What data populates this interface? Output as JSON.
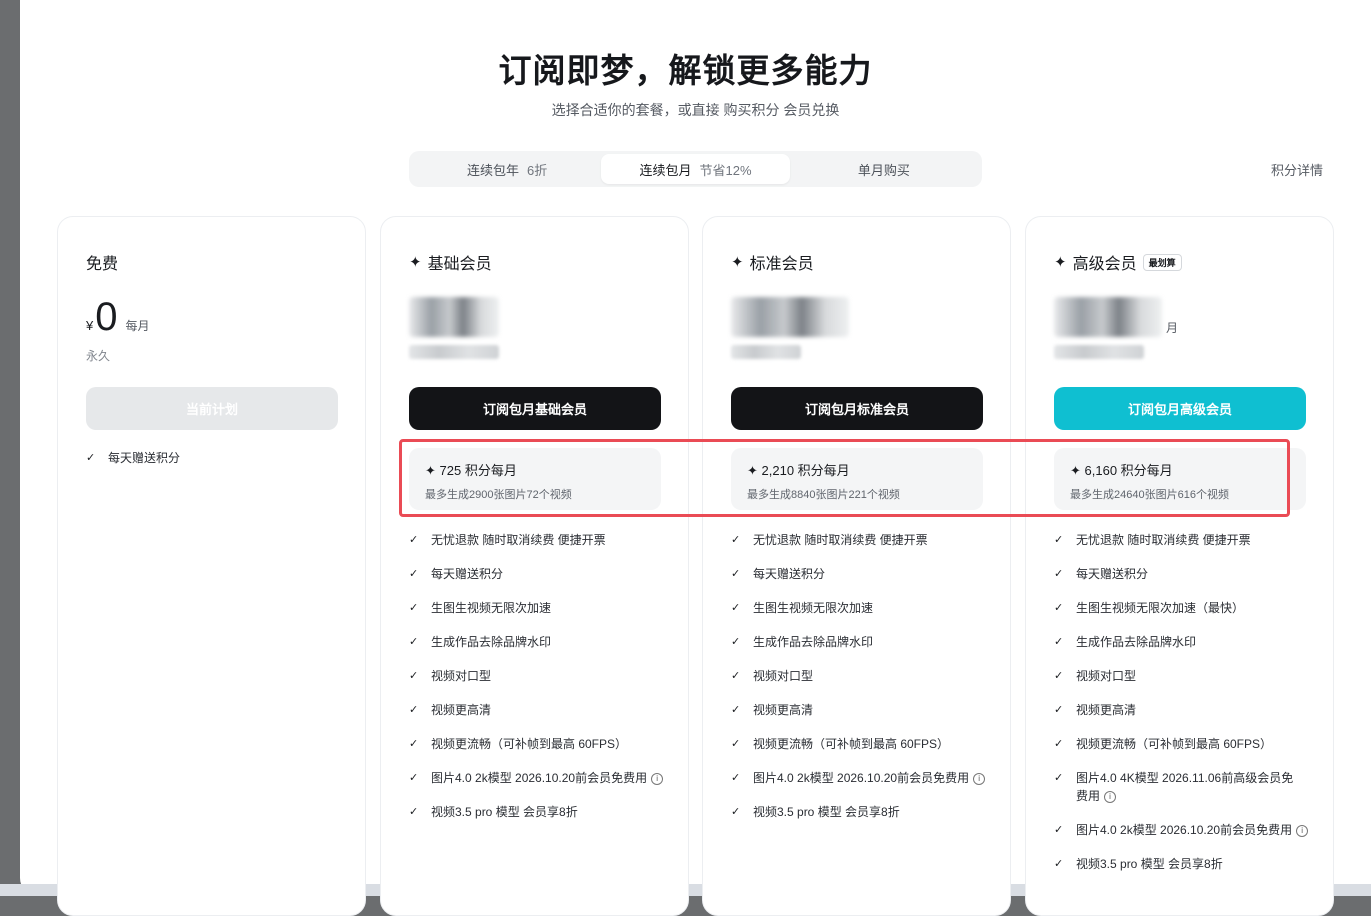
{
  "header": {
    "title": "订阅即梦，解锁更多能力",
    "subtitle": "选择合适你的套餐，或直接 购买积分 会员兑换"
  },
  "tabs": [
    {
      "label": "连续包年",
      "sub": "6折",
      "active": false
    },
    {
      "label": "连续包月",
      "sub": "节省12%",
      "active": true
    },
    {
      "label": "单月购买",
      "sub": "",
      "active": false
    }
  ],
  "credits_detail": "积分详情",
  "plans": [
    {
      "name": "免费",
      "currency": "¥",
      "price": "0",
      "period": "每月",
      "note": "永久",
      "cta": "当前计划",
      "features": [
        "每天赠送积分"
      ]
    },
    {
      "name": "基础会员",
      "icon": "sparkle-icon",
      "cta": "订阅包月基础会员",
      "credits": "725 积分每月",
      "credits_detail": "最多生成2900张图片72个视频",
      "features": [
        "无忧退款 随时取消续费 便捷开票",
        "每天赠送积分",
        "生图生视频无限次加速",
        "生成作品去除品牌水印",
        "视频对口型",
        "视频更高清",
        "视频更流畅（可补帧到最高 60FPS）",
        "图片4.0 2k模型 2026.10.20前会员免费用",
        "视频3.5 pro 模型 会员享8折"
      ]
    },
    {
      "name": "标准会员",
      "icon": "sparkles-icon",
      "cta": "订阅包月标准会员",
      "credits": "2,210 积分每月",
      "credits_detail": "最多生成8840张图片221个视频",
      "features": [
        "无忧退款 随时取消续费 便捷开票",
        "每天赠送积分",
        "生图生视频无限次加速",
        "生成作品去除品牌水印",
        "视频对口型",
        "视频更高清",
        "视频更流畅（可补帧到最高 60FPS）",
        "图片4.0 2k模型 2026.10.20前会员免费用",
        "视频3.5 pro 模型 会员享8折"
      ]
    },
    {
      "name": "高级会员",
      "icon": "sparkles-icon",
      "badge": "最划算",
      "period": "月",
      "cta": "订阅包月高级会员",
      "credits": "6,160 积分每月",
      "credits_detail": "最多生成24640张图片616个视频",
      "features": [
        "无忧退款 随时取消续费 便捷开票",
        "每天赠送积分",
        "生图生视频无限次加速（最快）",
        "生成作品去除品牌水印",
        "视频对口型",
        "视频更高清",
        "视频更流畅（可补帧到最高 60FPS）",
        "图片4.0 4K模型 2026.11.06前高级会员免费用",
        "图片4.0 2k模型 2026.10.20前会员免费用",
        "视频3.5 pro 模型 会员享8折"
      ]
    }
  ],
  "icons": {
    "check": "check-icon",
    "star": "four-point-star-icon",
    "info": "info-icon"
  },
  "colors": {
    "primary_button": "#131417",
    "premium_button": "#0fbfd1",
    "highlight_border": "#ea4b55"
  }
}
